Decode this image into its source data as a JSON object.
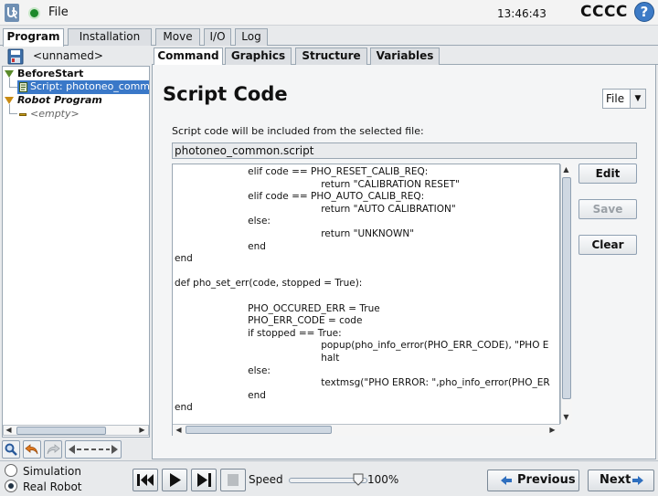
{
  "titlebar": {
    "file_menu": "File",
    "clock": "13:46:43",
    "robot_name": "CCCC",
    "help_label": "?"
  },
  "main_tabs": [
    {
      "label": "Program",
      "active": true
    },
    {
      "label": "Installation",
      "active": false
    },
    {
      "label": "Move",
      "active": false
    },
    {
      "label": "I/O",
      "active": false
    },
    {
      "label": "Log",
      "active": false
    }
  ],
  "program": {
    "name": "<unnamed>"
  },
  "tree": {
    "before_start": "BeforeStart",
    "script_item": "Script: photoneo_comm",
    "robot_program": "Robot Program",
    "empty_item": "<empty>"
  },
  "sub_tabs": [
    {
      "label": "Command",
      "active": true
    },
    {
      "label": "Graphics",
      "active": false
    },
    {
      "label": "Structure",
      "active": false
    },
    {
      "label": "Variables",
      "active": false
    }
  ],
  "script": {
    "title": "Script Code",
    "source_dropdown": "File",
    "description": "Script code will be included from the selected file:",
    "filename": "photoneo_common.script",
    "code_lines": [
      "                        elif code == PHO_RESET_CALIB_REQ:",
      "                                                return \"CALIBRATION RESET\"",
      "                        elif code == PHO_AUTO_CALIB_REQ:",
      "                                                return \"AUTO CALIBRATION\"",
      "                        else:",
      "                                                return \"UNKNOWN\"",
      "                        end",
      "end",
      "",
      "def pho_set_err(code, stopped = True):",
      "",
      "                        PHO_OCCURED_ERR = True",
      "                        PHO_ERR_CODE = code",
      "                        if stopped == True:",
      "                                                popup(pho_info_error(PHO_ERR_CODE), \"PHO E",
      "                                                halt",
      "                        else:",
      "                                                textmsg(\"PHO ERROR: \",pho_info_error(PHO_ER",
      "                        end",
      "end"
    ],
    "buttons": {
      "edit": "Edit",
      "save": "Save",
      "clear": "Clear"
    }
  },
  "footer": {
    "simulation": "Simulation",
    "real_robot": "Real Robot",
    "mode_selected": "Simulation",
    "speed_label": "Speed",
    "speed_value": "100%",
    "previous": "Previous",
    "next": "Next"
  },
  "colors": {
    "accent": "#3a78c8",
    "status_green": "#1c8a2a",
    "help_blue": "#3d7bc6"
  },
  "icons": [
    "ur-logo-icon",
    "status-dot-icon",
    "help-icon",
    "save-icon",
    "search-icon",
    "undo-icon",
    "redo-icon",
    "move-arrows-icon",
    "rewind-icon",
    "play-icon",
    "step-icon",
    "stop-icon",
    "arrow-left-icon",
    "arrow-right-icon"
  ]
}
